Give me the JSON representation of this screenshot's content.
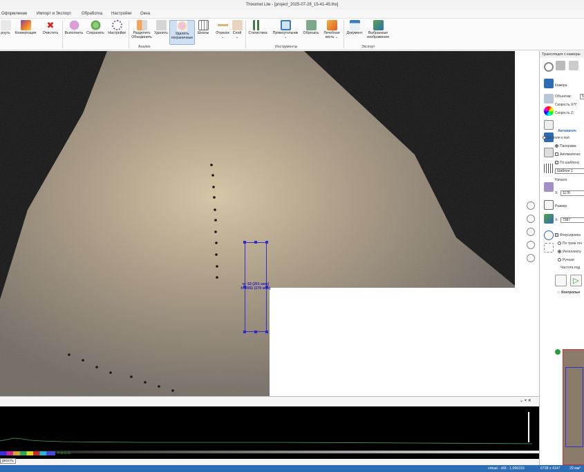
{
  "window": {
    "title": "Thixomet Lite - [project_2025-07-28_15-41-45.thx]"
  },
  "menu": [
    "Оформление",
    "Импорт и Экспорт",
    "Обработка",
    "Настройки",
    "Окна"
  ],
  "ribbon": {
    "buttons": [
      {
        "id": "restore",
        "l1": "рнуть",
        "l2": ""
      },
      {
        "id": "convert",
        "l1": "Конвертация",
        "l2": ""
      },
      {
        "id": "clear",
        "l1": "Очистить",
        "l2": ""
      },
      {
        "id": "execute",
        "l1": "Выполнить",
        "l2": ""
      },
      {
        "id": "save",
        "l1": "Сохранить",
        "l2": ""
      },
      {
        "id": "settings",
        "l1": "Настройки",
        "l2": ""
      },
      {
        "id": "split",
        "l1": "Разделить",
        "l2": "Объединить"
      },
      {
        "id": "delete",
        "l1": "Удалить",
        "l2": ""
      },
      {
        "id": "delete-border",
        "l1": "Удалить",
        "l2": "пограничные"
      },
      {
        "id": "scales",
        "l1": "Шкалы",
        "l2": ""
      },
      {
        "id": "segment",
        "l1": "Отрезок",
        "l2": "⌄"
      },
      {
        "id": "layer",
        "l1": "Слой",
        "l2": "⌄"
      },
      {
        "id": "statistics",
        "l1": "Статистика",
        "l2": ""
      },
      {
        "id": "rectangle",
        "l1": "Прямоугольник",
        "l2": "⌄"
      },
      {
        "id": "crop",
        "l1": "Обрезать",
        "l2": ""
      },
      {
        "id": "healing-brush",
        "l1": "Лечебная",
        "l2": "кисть ⌄"
      },
      {
        "id": "document",
        "l1": "Документ",
        "l2": ""
      },
      {
        "id": "selected-images",
        "l1": "Выбранные",
        "l2": "изображения"
      }
    ],
    "groups": {
      "analysis": "Анализ",
      "tools": "Инструменты",
      "export": "Экспорт"
    }
  },
  "selection": {
    "w": "w: 53 (201 мкм)",
    "h": "h: 2051 (179 мкм)"
  },
  "panel": {
    "title": "Трансляция с камеры",
    "camera": "Камера",
    "objective": "Объектив:",
    "objective_val": "5",
    "speed_xy": "Скорость X/Y:",
    "speed_z": "Скорость Z:",
    "auto_header": "Автоматич",
    "from_field": "От поля к пол",
    "panorama": "Панорама",
    "automatic": "Автоматичес",
    "by_template": "По шаблону",
    "template": "Шаблон 1",
    "start": "Начало",
    "x_start": "1178",
    "size": "Размер",
    "x_size": "7387",
    "focus": "Фокусировка",
    "three_points": "По трем точ",
    "intelligent": "Интеллекту",
    "manual": "Ручная",
    "freq": "Частота под",
    "control": "Контрольн",
    "x_label": "X:"
  },
  "bottom": {
    "brightness": "ркость",
    "controls": "⌄ ⌖ ✕",
    "icons": "✕⊕⊖⊖"
  },
  "status": {
    "zoom": "virtual - x55 : 1,096319",
    "size": "6738 x 4147",
    "area": "29 мм²"
  },
  "colors": {
    "accent": "#2b6cb5",
    "selection": "#3030d0"
  }
}
